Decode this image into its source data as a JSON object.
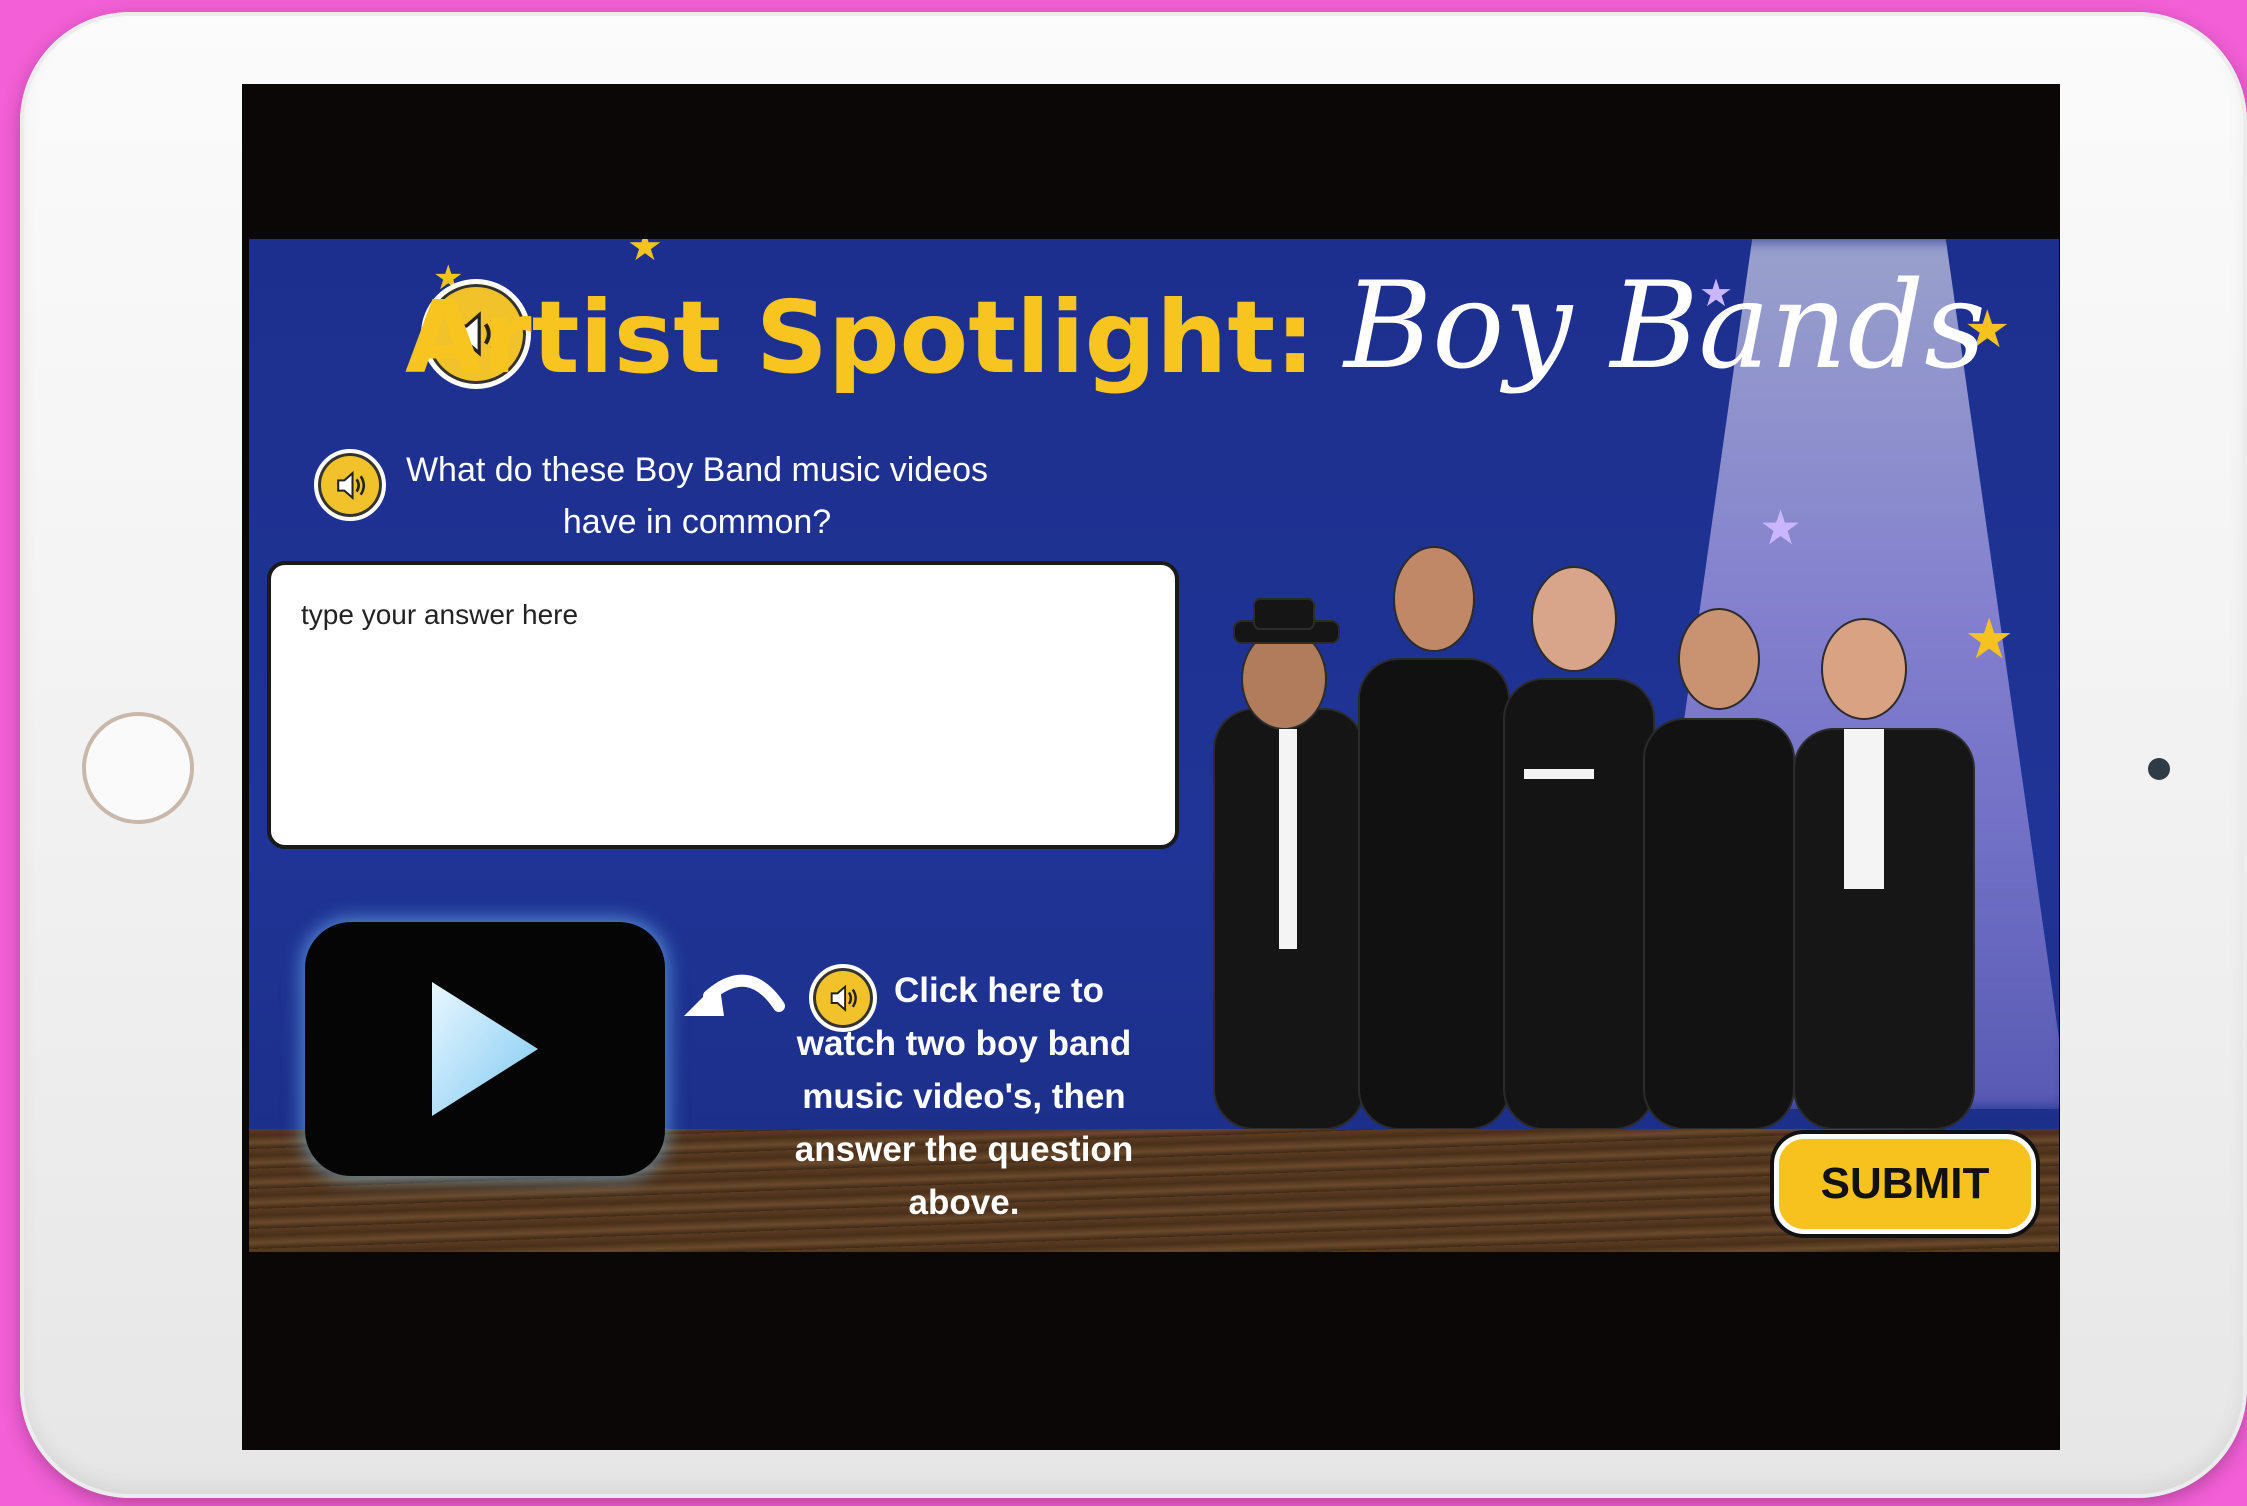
{
  "slide": {
    "title_prefix": "Artist Spotlight:",
    "title_highlight": "Boy Bands",
    "question_line1": "What do these Boy Band music videos",
    "question_line2": "have in common?",
    "answer_placeholder": "type your answer here",
    "instructions_lines": [
      "Click here to",
      "watch two boy band",
      "music video's, then",
      "answer the question",
      "above."
    ],
    "submit_label": "SUBMIT"
  },
  "icons": {
    "title_audio": "speaker-icon",
    "question_audio": "speaker-icon",
    "instructions_audio": "speaker-icon",
    "play": "play-icon",
    "arrow": "curved-arrow-icon"
  },
  "colors": {
    "page_background": "#f25fd6",
    "slide_background": "#1f3496",
    "accent_yellow": "#f7c420",
    "play_glow": "#78c8ff"
  }
}
